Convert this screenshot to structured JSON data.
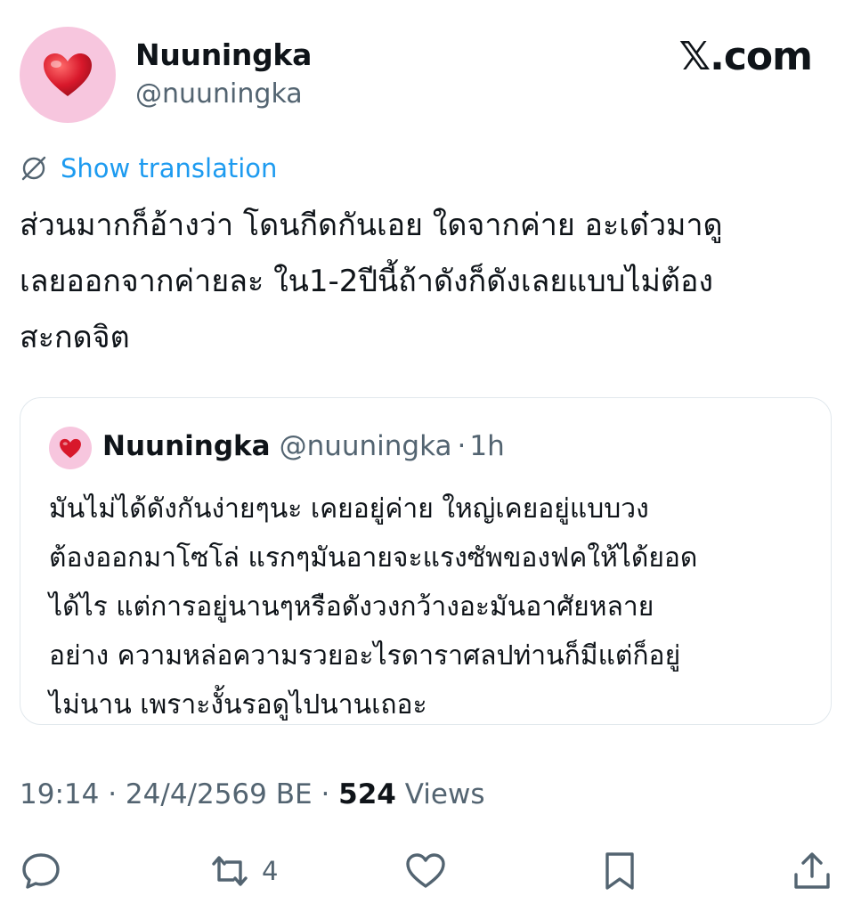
{
  "author": {
    "display_name": "Nuuningka",
    "handle": "@nuuningka",
    "avatar_icon": "heart-emoji"
  },
  "brand": "𝕏.com",
  "translate": {
    "icon": "globe-icon",
    "label": "Show translation"
  },
  "tweet": {
    "text": "ส่วนมากก็อ้างว่า โดนกีดกันเอย ใดจากค่าย อะเด๋วมาดู\nเลยออกจากค่ายละ ใน1-2ปีนี้ถ้าดังก็ดังเลยแบบไม่ต้อง\nสะกดจิต"
  },
  "quote": {
    "display_name": "Nuuningka",
    "handle": "@nuuningka",
    "separator": "·",
    "time": "1h",
    "text": "มันไม่ได้ดังกันง่ายๆนะ เคยอยู่ค่าย ใหญ่เคยอยู่แบบวง\nต้องออกมาโซโล่ แรกๆมันอายจะแรงซัพของฟคให้ได้ยอด\nได้ไร แต่การอยู่นานๆหรือดังวงกว้างอะมันอาศัยหลาย\nอย่าง ความหล่อความรวยอะไรดาราศลปท่านก็มีแต่ก็อยู่\nไม่นาน เพราะงั้นรอดูไปนานเถอะ"
  },
  "meta": {
    "time": "19:14",
    "sep1": "·",
    "date": "24/4/2569 BE",
    "sep2": "·",
    "views_count": "524",
    "views_label": "Views"
  },
  "actions": {
    "reply_count": "",
    "repost_count": "4",
    "like_count": "",
    "icons": [
      "reply-icon",
      "repost-icon",
      "like-icon",
      "bookmark-icon",
      "share-icon"
    ]
  },
  "colors": {
    "accent": "#1d9bf0",
    "secondary_text": "#536471",
    "avatar_bg": "#f7c6de",
    "heart": "#d8182b"
  }
}
